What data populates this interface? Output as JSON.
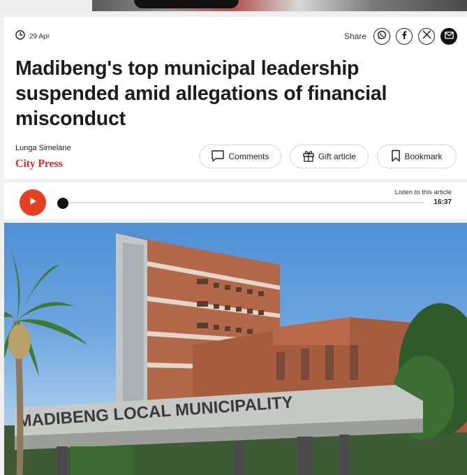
{
  "article": {
    "date": "29 Apr",
    "headline": "Madibeng's top municipal leadership suspended amid allegations of financial misconduct",
    "author": "Lunga Simelane",
    "publication": "City Press"
  },
  "share": {
    "label": "Share",
    "icons": [
      "whatsapp-icon",
      "facebook-icon",
      "x-icon",
      "mail-icon"
    ]
  },
  "actions": {
    "comments": "Comments",
    "gift": "Gift article",
    "bookmark": "Bookmark"
  },
  "player": {
    "listen_label": "Listen to this article",
    "duration": "16:37",
    "progress": 0
  },
  "hero": {
    "sign_text": "MADIBENG LOCAL MUNICIPALITY"
  },
  "colors": {
    "brand_red": "#d32f2f",
    "play_orange": "#e5401f"
  }
}
